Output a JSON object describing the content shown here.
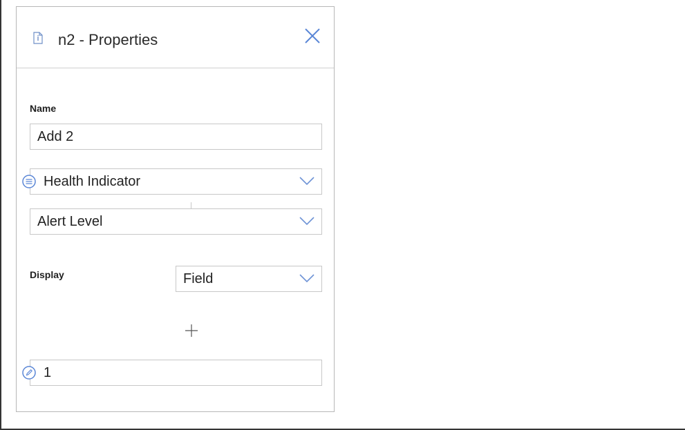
{
  "panel": {
    "title": "n2 - Properties",
    "header_icon": "info-document-icon",
    "close_icon": "close-icon"
  },
  "name_field": {
    "label": "Name",
    "value": "Add 2"
  },
  "source_selector": {
    "value": "Health Indicator",
    "icon": "list-icon",
    "dropdown_icon": "chevron-down-icon"
  },
  "field_selector": {
    "value": "Alert Level",
    "dropdown_icon": "chevron-down-icon"
  },
  "display": {
    "label": "Display",
    "value": "Field",
    "dropdown_icon": "chevron-down-icon"
  },
  "add_button": {
    "icon": "plus-icon"
  },
  "constant_field": {
    "value": "1",
    "icon": "pencil-icon"
  },
  "colors": {
    "accent_blue": "#4f7fd1",
    "border": "#c7c7c7",
    "panel_border": "#b7b7b7"
  }
}
